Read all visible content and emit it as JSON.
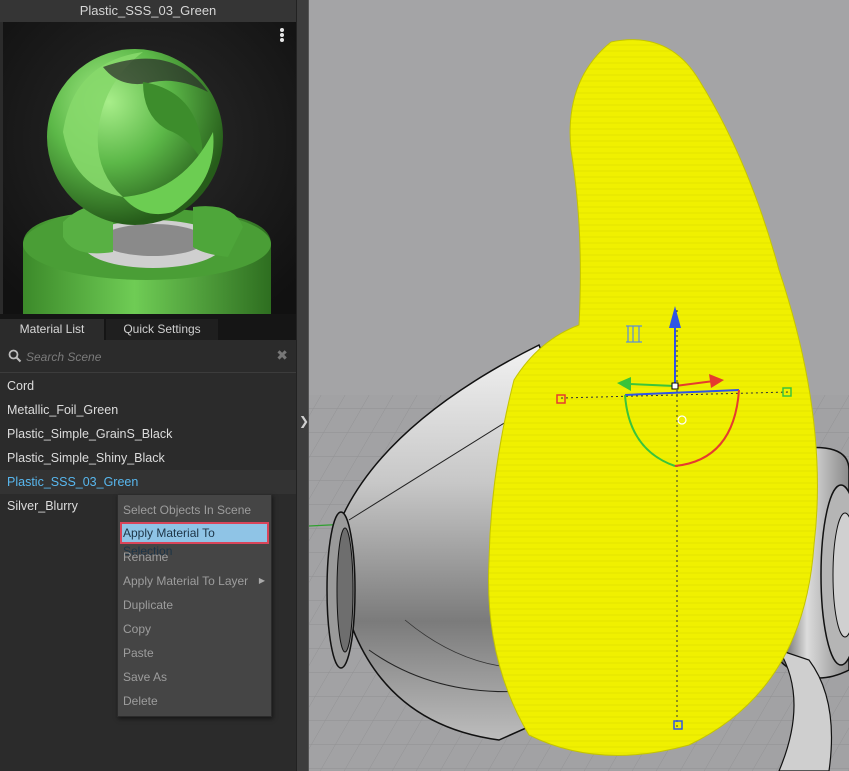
{
  "panel": {
    "title": "Plastic_SSS_03_Green"
  },
  "tabs": {
    "material_list": "Material List",
    "quick_settings": "Quick Settings"
  },
  "search": {
    "placeholder": "Search Scene",
    "value": ""
  },
  "materials": [
    "Cord",
    "Metallic_Foil_Green",
    "Plastic_Simple_GrainS_Black",
    "Plastic_Simple_Shiny_Black",
    "Plastic_SSS_03_Green",
    "Silver_Blurry"
  ],
  "selected_material": "Plastic_SSS_03_Green",
  "context_menu": {
    "items": [
      "Select Objects In Scene",
      "Apply Material To Selection",
      "Rename",
      "Apply Material To Layer",
      "Duplicate",
      "Copy",
      "Paste",
      "Save As",
      "Delete"
    ],
    "highlighted": "Apply Material To Selection",
    "submenu_item": "Apply Material To Layer"
  },
  "colors": {
    "selection_text": "#58b7ee",
    "highlight_bg": "#8fc4e6",
    "highlight_border": "#d9455a",
    "object_yellow": "#f0f000",
    "material_green": "#5cb848",
    "gizmo_x": "#e53b2e",
    "gizmo_y": "#3ac43a",
    "gizmo_z": "#2f55e6"
  },
  "icons": {
    "search": "search-icon",
    "clear": "close-icon",
    "menu": "more-vertical-icon",
    "splitter": "chevron-right-icon",
    "submenu": "chevron-right-icon"
  }
}
